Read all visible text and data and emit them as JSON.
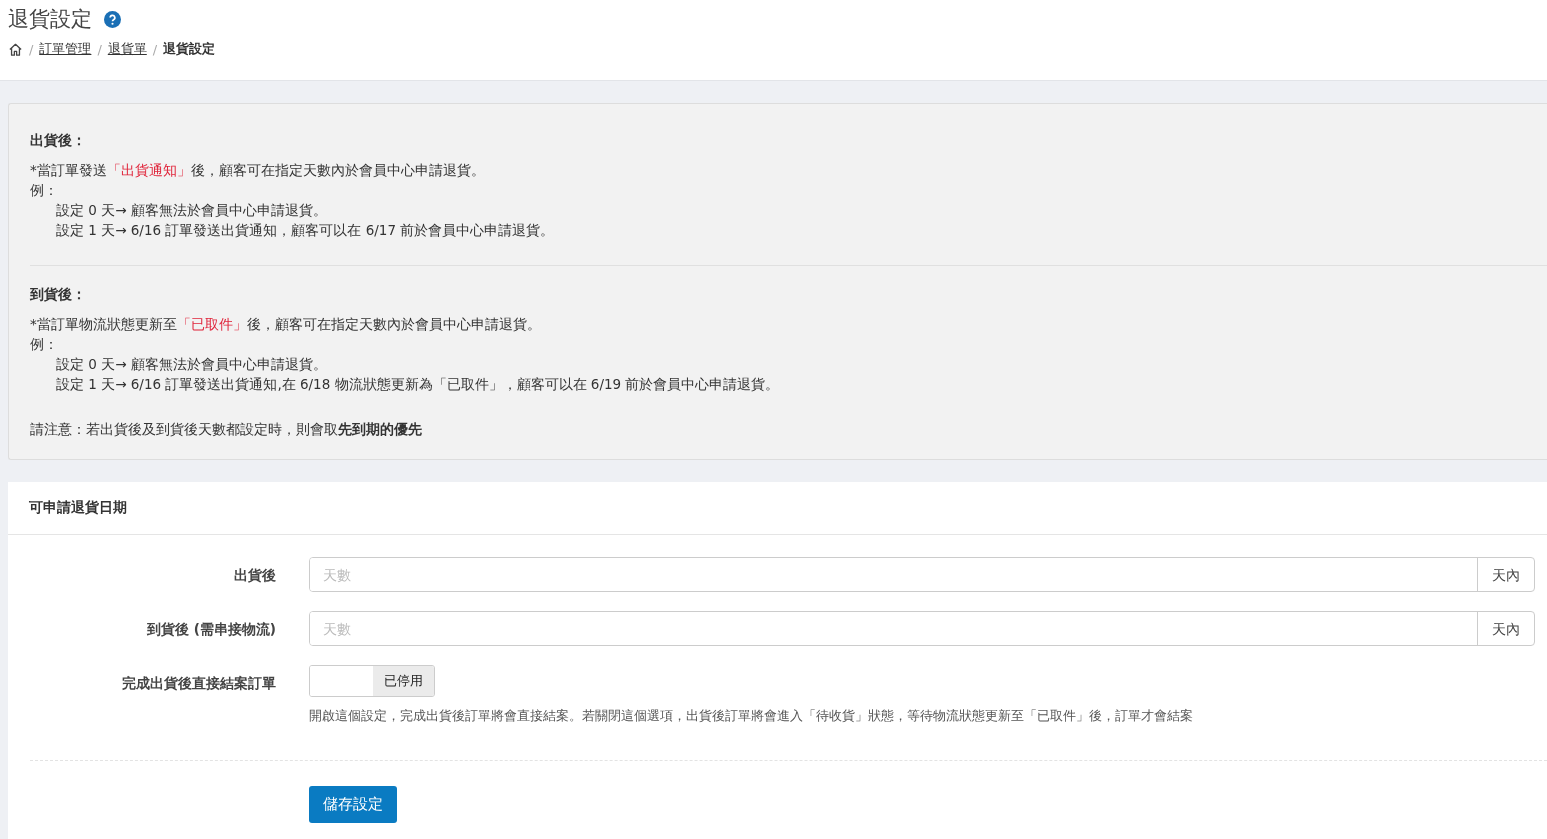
{
  "page": {
    "title": "退貨設定",
    "breadcrumb": [
      {
        "separator": "/",
        "label": "訂單管理",
        "link": true
      },
      {
        "separator": "/",
        "label": "退貨單",
        "link": true
      },
      {
        "separator": "/",
        "label": "退貨設定",
        "link": false
      }
    ]
  },
  "info": {
    "sections": [
      {
        "heading": "出貨後：",
        "intro": [
          {
            "text": "*當訂單發送",
            "highlight": false
          },
          {
            "text": "「出貨通知」",
            "highlight": true
          },
          {
            "text": "後，顧客可在指定天數內於會員中心申請退貨。",
            "highlight": false
          }
        ],
        "example_label": "例：",
        "examples": [
          "設定 0 天→ 顧客無法於會員中心申請退貨。",
          "設定 1 天→ 6/16 訂單發送出貨通知，顧客可以在 6/17 前於會員中心申請退貨。"
        ]
      },
      {
        "heading": "到貨後：",
        "intro": [
          {
            "text": "*當訂單物流狀態更新至",
            "highlight": false
          },
          {
            "text": "「已取件」",
            "highlight": true
          },
          {
            "text": "後，顧客可在指定天數內於會員中心申請退貨。",
            "highlight": false
          }
        ],
        "example_label": "例：",
        "examples": [
          "設定 0 天→ 顧客無法於會員中心申請退貨。",
          "設定 1 天→ 6/16 訂單發送出貨通知,在 6/18 物流狀態更新為「已取件」，顧客可以在 6/19 前於會員中心申請退貨。"
        ]
      }
    ],
    "note": "請注意：若出貨後及到貨後天數都設定時，則會取**先到期的優先**"
  },
  "form": {
    "title": "可申請退貨日期",
    "fields": [
      {
        "kind": "input",
        "label": "出貨後",
        "placeholder": "天數",
        "addon": "天內"
      },
      {
        "kind": "input",
        "label": "到貨後 (需串接物流)",
        "placeholder": "天數",
        "addon": "天內"
      },
      {
        "kind": "toggle",
        "label": "完成出貨後直接結案訂單",
        "on": false,
        "state_label": "已停用",
        "help": "開啟這個設定，完成出貨後訂單將會直接結案。若關閉這個選項，出貨後訂單將會進入「待收貨」狀態，等待物流狀態更新至「已取件」後，訂單才會結案"
      }
    ],
    "save_button": "儲存設定"
  }
}
